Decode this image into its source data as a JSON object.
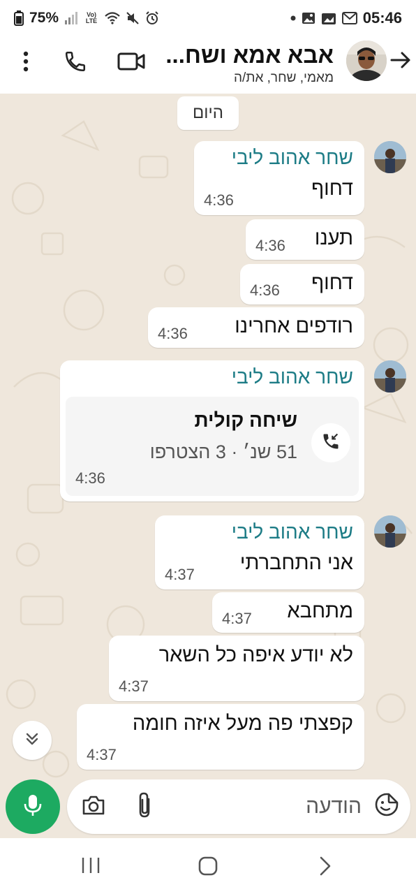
{
  "status_bar": {
    "battery_percent": "75%",
    "network_label": "Vo) LTE",
    "time": "05:46",
    "icons": [
      "battery-icon",
      "signal-icon",
      "volte-icon",
      "wifi-icon",
      "mute-icon",
      "alarm-icon",
      "dot-icon",
      "gallery-icon",
      "image-icon",
      "gmail-icon"
    ]
  },
  "header": {
    "title": "אבא אמא ושח...",
    "subtitle": "מאמי, שחר, את/ה",
    "icons": [
      "more-icon",
      "phone-icon",
      "video-icon",
      "back-arrow-icon"
    ]
  },
  "chat": {
    "date_label": "היום",
    "messages": [
      {
        "sender": "שחר אהוב ליבי",
        "text": "דחוף",
        "time": "4:36"
      },
      {
        "text": "תענו",
        "time": "4:36"
      },
      {
        "text": "דחוף",
        "time": "4:36"
      },
      {
        "text": "רודפים אחרינו",
        "time": "4:36"
      },
      {
        "sender": "שחר אהוב ליבי",
        "call": {
          "title": "שיחה קולית",
          "detail": "51 שנ׳ · 3 הצטרפו"
        },
        "time": "4:36"
      },
      {
        "sender": "שחר אהוב ליבי",
        "text": "אני התחברתי",
        "time": "4:37"
      },
      {
        "text": "מתחבא",
        "time": "4:37"
      },
      {
        "text": "לא יודע איפה כל השאר",
        "time": "4:37"
      },
      {
        "text": "קפצתי פה מעל איזה חומה",
        "time": "4:37"
      }
    ]
  },
  "composer": {
    "placeholder": "הודעה",
    "icons": [
      "mic-icon",
      "camera-icon",
      "attach-icon",
      "emoji-icon"
    ]
  },
  "colors": {
    "wallpaper": "#efe7dc",
    "sender_name": "#1d7c86",
    "mic_button": "#1daa61",
    "bubble": "#ffffff"
  }
}
